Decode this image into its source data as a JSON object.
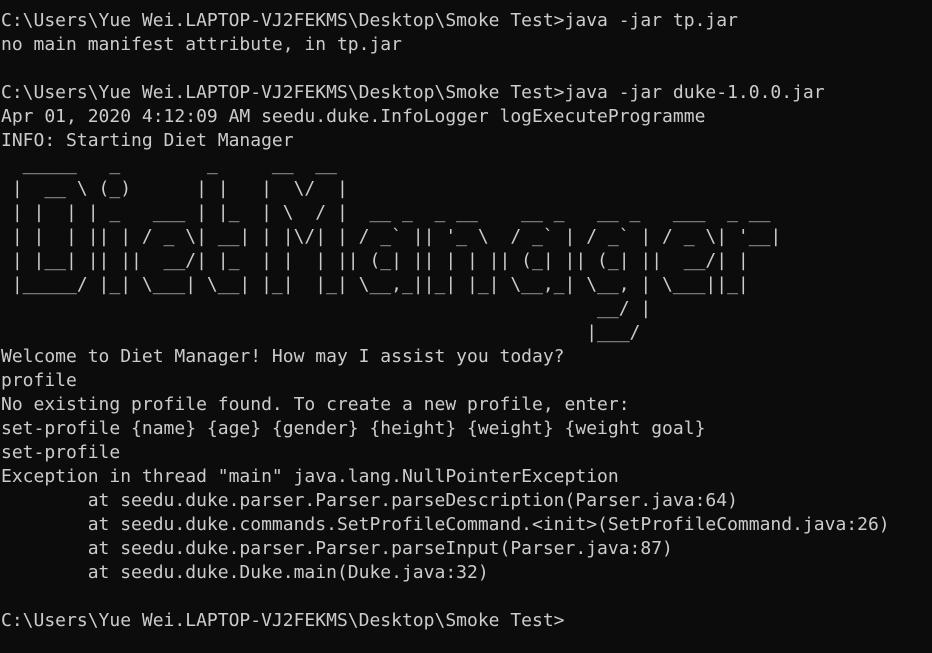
{
  "console": {
    "lines": [
      "C:\\Users\\Yue Wei.LAPTOP-VJ2FEKMS\\Desktop\\Smoke Test>java -jar tp.jar",
      "no main manifest attribute, in tp.jar",
      "",
      "C:\\Users\\Yue Wei.LAPTOP-VJ2FEKMS\\Desktop\\Smoke Test>java -jar duke-1.0.0.jar",
      "Apr 01, 2020 4:12:09 AM seedu.duke.InfoLogger logExecuteProgramme",
      "INFO: Starting Diet Manager",
      "  _____   _        _     __  __",
      " |  __ \\ (_)      | |   |  \\/  |",
      " | |  | | _   ___ | |_  | \\  / |  __ _  _ __    __ _   __ _   ___  _ __",
      " | |  | || | / _ \\| __| | |\\/| | / _` || '_ \\  / _` | / _` | / _ \\| '__|",
      " | |__| || ||  __/| |_  | |  | || (_| || | | || (_| || (_| ||  __/| |",
      " |_____/ |_| \\___| \\__| |_|  |_| \\__,_||_| |_| \\__,_| \\__, | \\___||_|",
      "                                                       __/ |",
      "                                                      |___/",
      "Welcome to Diet Manager! How may I assist you today?",
      "profile",
      "No existing profile found. To create a new profile, enter:",
      "set-profile {name} {age} {gender} {height} {weight} {weight goal}",
      "set-profile",
      "Exception in thread \"main\" java.lang.NullPointerException",
      "        at seedu.duke.parser.Parser.parseDescription(Parser.java:64)",
      "        at seedu.duke.commands.SetProfileCommand.<init>(SetProfileCommand.java:26)",
      "        at seedu.duke.parser.Parser.parseInput(Parser.java:87)",
      "        at seedu.duke.Duke.main(Duke.java:32)",
      ""
    ],
    "prompt": "C:\\Users\\Yue Wei.LAPTOP-VJ2FEKMS\\Desktop\\Smoke Test>"
  },
  "colors": {
    "background": "#0c0c0c",
    "foreground": "#cccccc"
  }
}
